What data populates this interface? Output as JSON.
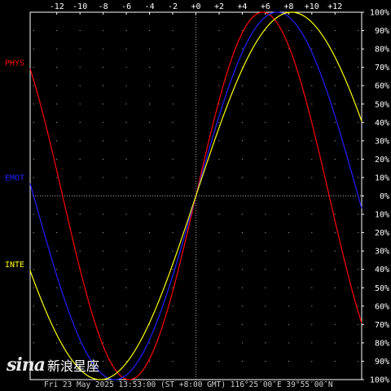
{
  "chart_data": {
    "type": "line",
    "x_ticks": [
      "-12",
      "-10",
      "-8",
      "-6",
      "-4",
      "-2",
      "+0",
      "+2",
      "+4",
      "+6",
      "+8",
      "+10",
      "+12"
    ],
    "y_ticks": [
      "100%",
      "90%",
      "80%",
      "70%",
      "60%",
      "50%",
      "40%",
      "30%",
      "20%",
      "10%",
      "0%",
      "10%",
      "20%",
      "30%",
      "40%",
      "50%",
      "60%",
      "70%",
      "80%",
      "90%",
      "100%"
    ],
    "xlim": [
      -14.3,
      14.3
    ],
    "ylim": [
      -100,
      100
    ],
    "grid": "dotted",
    "series": [
      {
        "name": "PHYS",
        "color": "#ff0000",
        "period": 23
      },
      {
        "name": "EMOT",
        "color": "#2020ff",
        "period": 28
      },
      {
        "name": "INTE",
        "color": "#ffff00",
        "period": 33
      }
    ]
  },
  "footer": "Fri 23 May 2025 13:53:00 (ST +8:00 GMT) 116°25′00″E 39°55′00″N",
  "logo": {
    "mark": "sina",
    "text": "新浪星座"
  }
}
